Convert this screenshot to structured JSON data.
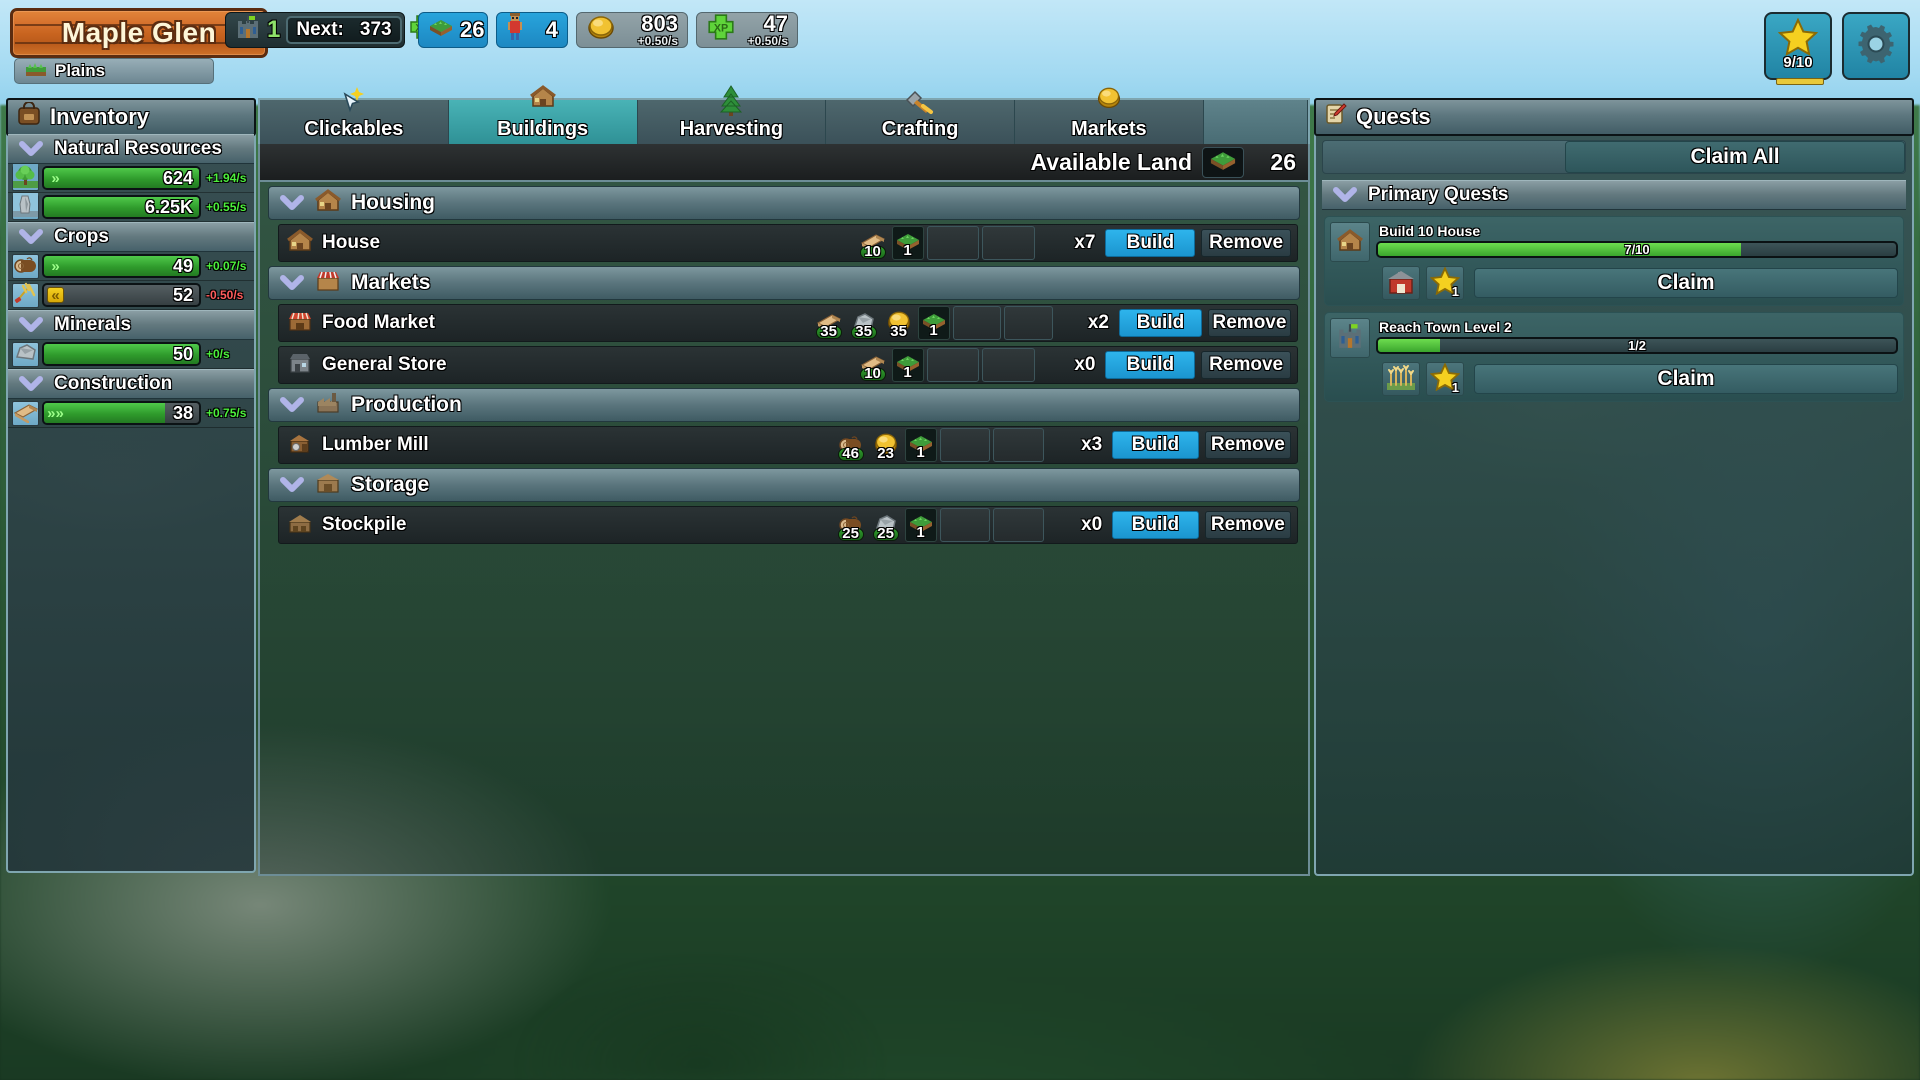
{
  "header": {
    "town_name": "Maple Glen",
    "biome": "Plains",
    "biome_icon": "grass-icon",
    "town_level": "1",
    "next_label": "Next:",
    "next_value": "373",
    "xp_icon": "xp-icon",
    "land": {
      "icon": "land-icon",
      "value": "26"
    },
    "population": {
      "icon": "villager-icon",
      "value": "4"
    },
    "gold": {
      "icon": "gold-coin-icon",
      "value": "803",
      "rate": "+0.50/s"
    },
    "xp": {
      "icon": "xp-icon",
      "value": "47",
      "rate": "+0.50/s"
    },
    "star_button": {
      "icon": "star-icon",
      "value": "9/10"
    },
    "settings_button": {
      "icon": "gear-icon"
    }
  },
  "inventory": {
    "title": "Inventory",
    "title_icon": "backpack-icon",
    "groups": [
      {
        "label": "Natural Resources",
        "items": [
          {
            "icon": "tree-icon",
            "value": "624",
            "rate": "+1.94/s",
            "rate_sign": "pos",
            "fill": 100,
            "mark": "»",
            "mark_color": "green"
          },
          {
            "icon": "stone-pillar-icon",
            "value": "6.25K",
            "rate": "+0.55/s",
            "rate_sign": "pos",
            "fill": 100,
            "mark": "",
            "mark_color": ""
          }
        ]
      },
      {
        "label": "Crops",
        "items": [
          {
            "icon": "log-icon",
            "value": "49",
            "rate": "+0.07/s",
            "rate_sign": "pos",
            "fill": 100,
            "mark": "»",
            "mark_color": "green"
          },
          {
            "icon": "wheat-icon",
            "value": "52",
            "rate": "-0.50/s",
            "rate_sign": "neg",
            "fill": 0,
            "mark": "«",
            "mark_color": "yellow"
          }
        ]
      },
      {
        "label": "Minerals",
        "items": [
          {
            "icon": "stone-icon",
            "value": "50",
            "rate": "+0/s",
            "rate_sign": "zero",
            "fill": 100,
            "mark": "",
            "mark_color": ""
          }
        ]
      },
      {
        "label": "Construction",
        "items": [
          {
            "icon": "plank-icon",
            "value": "38",
            "rate": "+0.75/s",
            "rate_sign": "pos",
            "fill": 78,
            "mark": "»»",
            "mark_color": "green"
          }
        ]
      }
    ]
  },
  "main": {
    "tabs": [
      {
        "label": "Clickables",
        "icon": "cursor-sparkle-icon",
        "active": false
      },
      {
        "label": "Buildings",
        "icon": "house-icon",
        "active": true
      },
      {
        "label": "Harvesting",
        "icon": "pine-tree-icon",
        "active": false
      },
      {
        "label": "Crafting",
        "icon": "hammer-icon",
        "active": false
      },
      {
        "label": "Markets",
        "icon": "gold-coin-icon",
        "active": false
      }
    ],
    "available_land": {
      "label": "Available Land",
      "icon": "land-icon",
      "value": "26"
    },
    "build_button_label": "Build",
    "remove_button_label": "Remove",
    "categories": [
      {
        "label": "Housing",
        "icon": "house-icon",
        "rows": [
          {
            "name": "House",
            "icon": "house-icon",
            "costs": [
              {
                "icon": "plank-icon",
                "amount": "10",
                "affordable": true
              },
              {
                "icon": "land-icon",
                "amount": "1",
                "affordable": false
              }
            ],
            "count": "x7"
          }
        ]
      },
      {
        "label": "Markets",
        "icon": "market-icon",
        "rows": [
          {
            "name": "Food Market",
            "icon": "food-market-icon",
            "costs": [
              {
                "icon": "plank-icon",
                "amount": "35",
                "affordable": true
              },
              {
                "icon": "stone-icon",
                "amount": "35",
                "affordable": true
              },
              {
                "icon": "gold-coin-icon",
                "amount": "35",
                "affordable": false
              },
              {
                "icon": "land-icon",
                "amount": "1",
                "affordable": false
              }
            ],
            "count": "x2"
          },
          {
            "name": "General Store",
            "icon": "store-icon",
            "costs": [
              {
                "icon": "plank-icon",
                "amount": "10",
                "affordable": true
              },
              {
                "icon": "land-icon",
                "amount": "1",
                "affordable": false
              }
            ],
            "count": "x0"
          }
        ]
      },
      {
        "label": "Production",
        "icon": "factory-icon",
        "rows": [
          {
            "name": "Lumber Mill",
            "icon": "lumber-mill-icon",
            "costs": [
              {
                "icon": "log-icon",
                "amount": "46",
                "affordable": true
              },
              {
                "icon": "gold-coin-icon",
                "amount": "23",
                "affordable": false
              },
              {
                "icon": "land-icon",
                "amount": "1",
                "affordable": false
              }
            ],
            "count": "x3"
          }
        ]
      },
      {
        "label": "Storage",
        "icon": "storage-icon",
        "rows": [
          {
            "name": "Stockpile",
            "icon": "stockpile-icon",
            "costs": [
              {
                "icon": "log-icon",
                "amount": "25",
                "affordable": true
              },
              {
                "icon": "stone-icon",
                "amount": "25",
                "affordable": true
              },
              {
                "icon": "land-icon",
                "amount": "1",
                "affordable": false
              }
            ],
            "count": "x0"
          }
        ]
      }
    ]
  },
  "quests": {
    "title": "Quests",
    "title_icon": "scroll-quill-icon",
    "claim_all_label": "Claim All",
    "group_label": "Primary Quests",
    "claim_label": "Claim",
    "items": [
      {
        "name": "Build 10 House",
        "icon": "house-icon",
        "progress_text": "7/10",
        "progress_pct": 70,
        "rewards": [
          {
            "icon": "red-barn-icon",
            "amount": ""
          },
          {
            "icon": "star-icon",
            "amount": "1"
          }
        ]
      },
      {
        "name": "Reach Town Level 2",
        "icon": "castle-icon",
        "progress_text": "1/2",
        "progress_pct": 12,
        "rewards": [
          {
            "icon": "wheat-field-icon",
            "amount": ""
          },
          {
            "icon": "star-icon",
            "amount": "1"
          }
        ]
      }
    ]
  },
  "colors": {
    "accent_blue": "#2eb4ec",
    "panel_border": "#7fa6b0",
    "bar_green": "#2f9b2c",
    "rate_positive": "#4cf03c",
    "rate_negative": "#ff5c5c",
    "sign_orange": "#c8641f"
  }
}
